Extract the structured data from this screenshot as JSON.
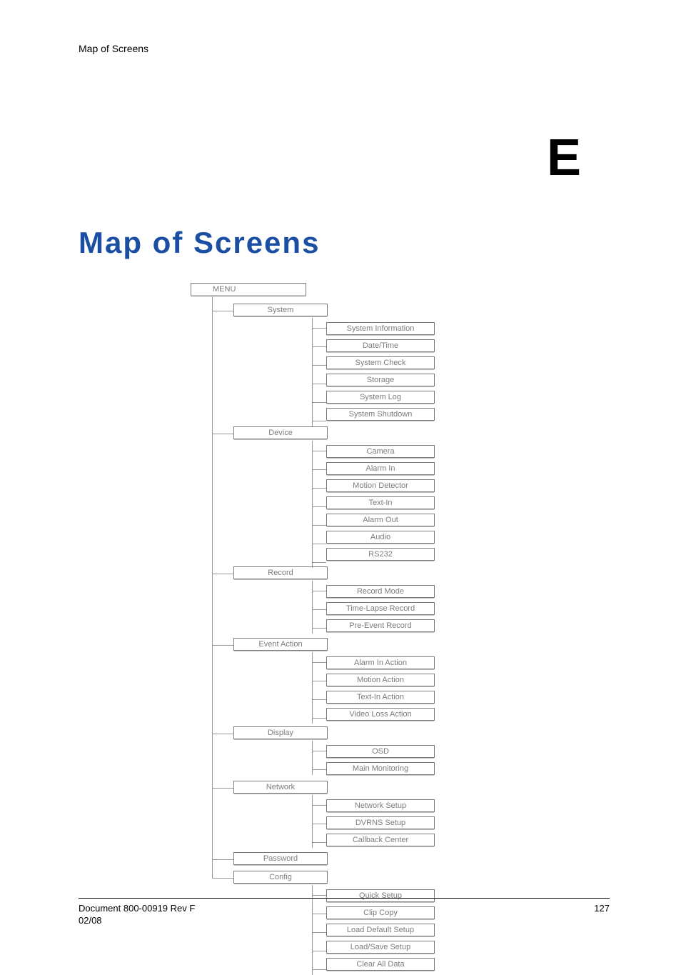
{
  "header": {
    "running_title": "Map of Screens"
  },
  "appendix_letter": "E",
  "title": "Map of Screens",
  "diagram": {
    "root": "MENU",
    "groups": [
      {
        "name": "System",
        "items": [
          "System Information",
          "Date/Time",
          "System Check",
          "Storage",
          "System Log",
          "System Shutdown"
        ]
      },
      {
        "name": "Device",
        "items": [
          "Camera",
          "Alarm In",
          "Motion Detector",
          "Text-In",
          "Alarm Out",
          "Audio",
          "RS232"
        ]
      },
      {
        "name": "Record",
        "items": [
          "Record Mode",
          "Time-Lapse Record",
          "Pre-Event Record"
        ]
      },
      {
        "name": "Event Action",
        "items": [
          "Alarm In Action",
          "Motion Action",
          "Text-In Action",
          "Video Loss Action"
        ]
      },
      {
        "name": "Display",
        "items": [
          "OSD",
          "Main Monitoring"
        ]
      },
      {
        "name": "Network",
        "items": [
          "Network Setup",
          "DVRNS Setup",
          "Callback Center"
        ]
      },
      {
        "name": "Password",
        "items": []
      },
      {
        "name": "Config",
        "items": [
          "Quick Setup",
          "Clip Copy",
          "Load Default Setup",
          "Load/Save Setup",
          "Clear All Data"
        ]
      }
    ]
  },
  "footer": {
    "doc": "Document 800-00919 Rev F",
    "date": "02/08",
    "page": "127"
  }
}
